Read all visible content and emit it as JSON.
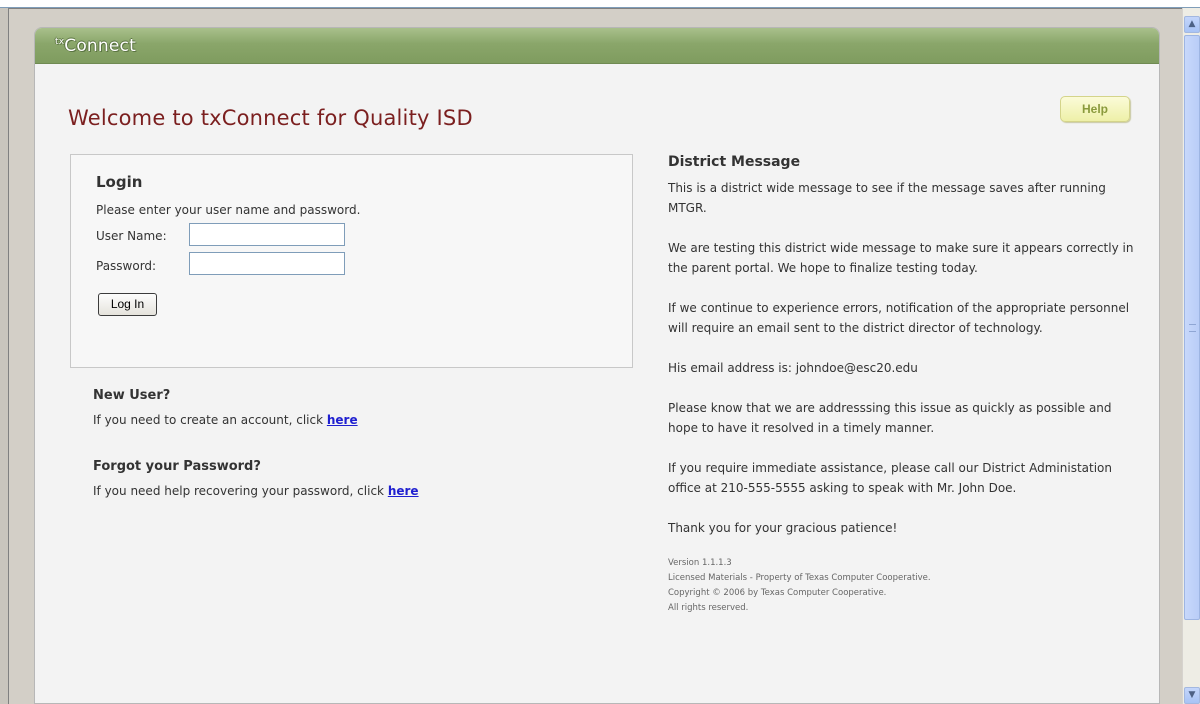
{
  "app": {
    "brand_prefix": "tx",
    "brand_name": "Connect",
    "welcome_title": "Welcome to txConnect for Quality ISD",
    "help_label": "Help"
  },
  "login": {
    "title": "Login",
    "instructions": "Please enter your user name and password.",
    "username_label": "User Name:",
    "username_value": "",
    "password_label": "Password:",
    "password_value": "",
    "submit_label": "Log In"
  },
  "new_user": {
    "title": "New User?",
    "text": "If you need to create an account, click ",
    "link": "here"
  },
  "forgot": {
    "title": "Forgot your Password?",
    "text": "If you need help recovering your password, click ",
    "link": "here"
  },
  "district_message": {
    "title": "District Message",
    "paragraphs": [
      "This is a district wide message to see if the message saves after running MTGR.",
      "We are testing this district wide message to make sure it appears correctly in the parent portal. We hope to finalize testing today.",
      "If we continue to experience errors, notification of the appropriate personnel will require an email sent to the district director of technology.",
      "His email address is: johndoe@esc20.edu",
      "Please know that we are addresssing this issue as quickly as possible and hope to have it resolved in a timely manner.",
      "If you require immediate assistance, please call our District Administation office at 210-555-5555 asking to speak with Mr. John Doe.",
      "Thank you for your gracious patience!"
    ]
  },
  "footer": {
    "version": "Version 1.1.1.3",
    "license": "Licensed Materials - Property of Texas Computer Cooperative.",
    "copyright": "Copyright © 2006 by Texas Computer Cooperative.",
    "rights": "All rights reserved."
  },
  "scrollbar": {
    "up_icon": "▲",
    "down_icon": "▼"
  }
}
